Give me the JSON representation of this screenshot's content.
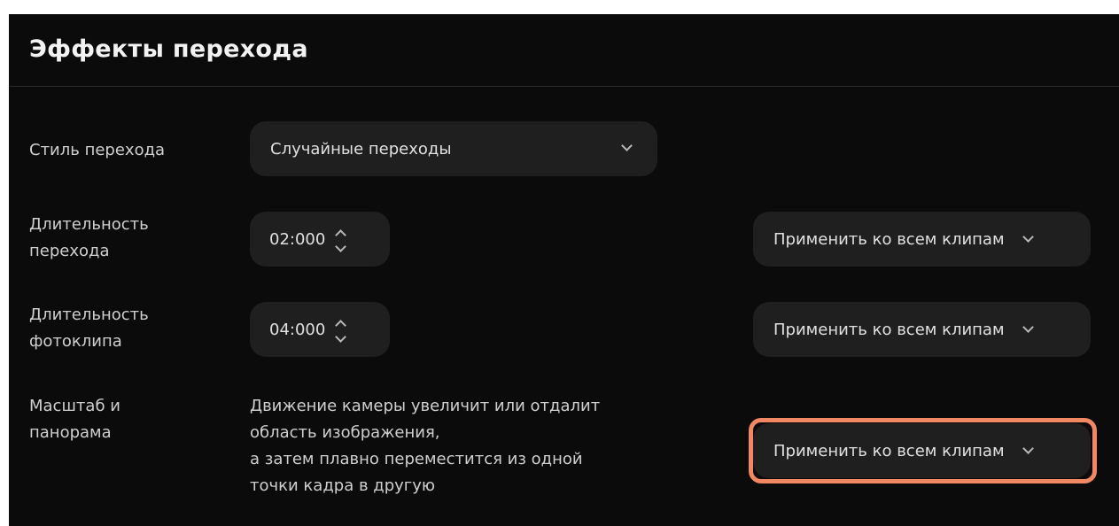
{
  "panel": {
    "title": "Эффекты перехода"
  },
  "transition_style": {
    "label": "Стиль перехода",
    "selected": "Случайные переходы",
    "chevron_icon": "chevron-down-icon"
  },
  "transition_duration": {
    "label_line1": "Длительность",
    "label_line2": "перехода",
    "value": "02:000",
    "apply_label": "Применить ко всем клипам"
  },
  "photo_duration": {
    "label_line1": "Длительность",
    "label_line2": "фотоклипа",
    "value": "04:000",
    "apply_label": "Применить ко всем клипам"
  },
  "pan_zoom": {
    "label_line1": "Масштаб и",
    "label_line2": "панорама",
    "description": [
      "Движение камеры увеличит или отдалит",
      "область изображения,",
      "а затем плавно переместится из одной",
      "точки кадра в другую"
    ],
    "apply_label": "Применить ко всем клипам",
    "highlighted": true,
    "highlight_color": "#f28763"
  }
}
